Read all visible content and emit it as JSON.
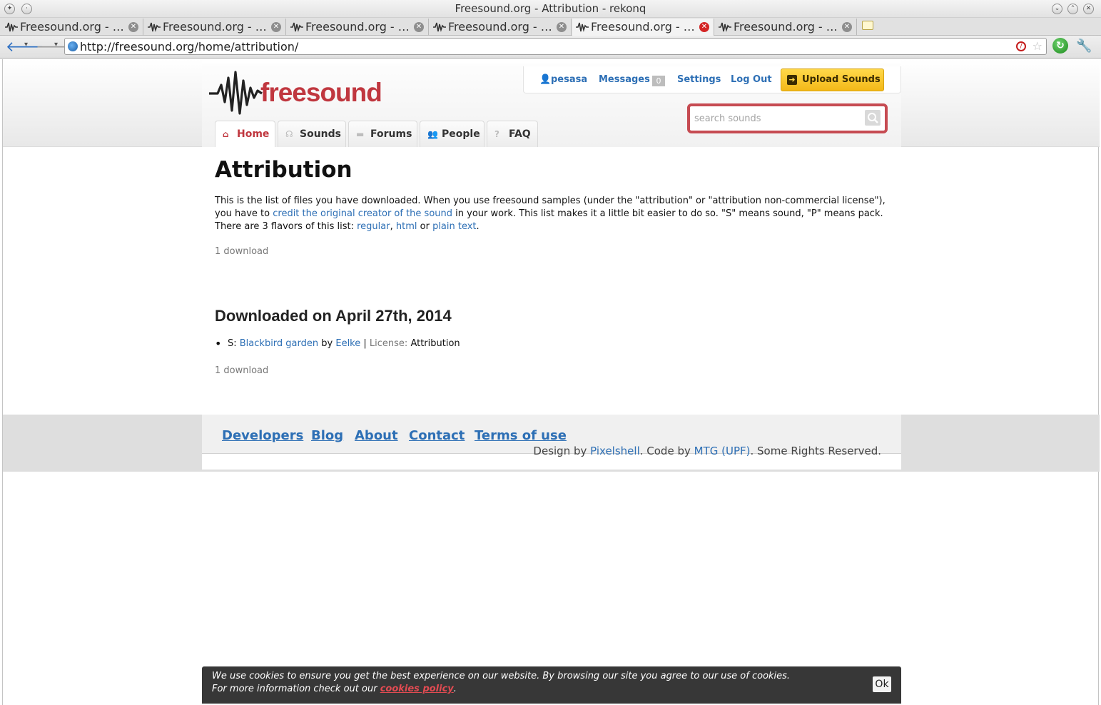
{
  "window": {
    "title": "Freesound.org - Attribution - rekonq"
  },
  "tabs": [
    {
      "label": "Freesound.org - …"
    },
    {
      "label": "Freesound.org - …"
    },
    {
      "label": "Freesound.org - …"
    },
    {
      "label": "Freesound.org - …"
    },
    {
      "label": "Freesound.org - …",
      "active": true
    },
    {
      "label": "Freesound.org - …"
    }
  ],
  "navbar": {
    "url": "http://freesound.org/home/attribution/"
  },
  "header": {
    "logo_text": "freesound",
    "user": "pesasa",
    "messages_label": "Messages",
    "messages_count": "0",
    "settings_label": "Settings",
    "logout_label": "Log Out",
    "upload_label": "Upload Sounds",
    "search_placeholder": "search sounds",
    "nav": [
      {
        "label": "Home",
        "active": true
      },
      {
        "label": "Sounds"
      },
      {
        "label": "Forums"
      },
      {
        "label": "People"
      },
      {
        "label": "FAQ"
      }
    ]
  },
  "content": {
    "title": "Attribution",
    "intro_1": "This is the list of files you have downloaded. When you use freesound samples (under the \"attribution\" or \"attribution non-commercial license\"), you have to ",
    "intro_link": "credit the original creator of the sound",
    "intro_2": " in your work. This list makes it a little bit easier to do so. \"S\" means sound, \"P\" means pack.",
    "flavors_prefix": "There are 3 flavors of this list: ",
    "flavor_regular": "regular",
    "flavor_sep": ", ",
    "flavor_html": "html",
    "flavor_or": " or ",
    "flavor_plain": "plain text",
    "flavor_end": ".",
    "count_top": "1 download",
    "section_heading": "Downloaded on April 27th, 2014",
    "items": [
      {
        "type": "S: ",
        "sound": "Blackbird garden",
        "by": " by ",
        "author": "Eelke",
        "sep": " | ",
        "license_label": "License: ",
        "license": "Attribution"
      }
    ],
    "count_bottom": "1 download"
  },
  "footer": {
    "links": [
      "Developers",
      "Blog",
      "About",
      "Contact",
      "Terms of use"
    ],
    "design_prefix": "Design by ",
    "design_link": "Pixelshell",
    "code_prefix": ". Code by ",
    "code_link": "MTG (UPF)",
    "rights": ". Some Rights Reserved."
  },
  "cookie": {
    "line1": "We use cookies to ensure you get the best experience on our website. By browsing our site you agree to our use of cookies.",
    "line2_prefix": "For more information check out our ",
    "policy_link": "cookies policy",
    "line2_end": ".",
    "ok_label": "Ok"
  },
  "colors": {
    "brand_red": "#c0373f",
    "link_blue": "#2d6fb5",
    "upload_yellow": "#ffd94a"
  }
}
